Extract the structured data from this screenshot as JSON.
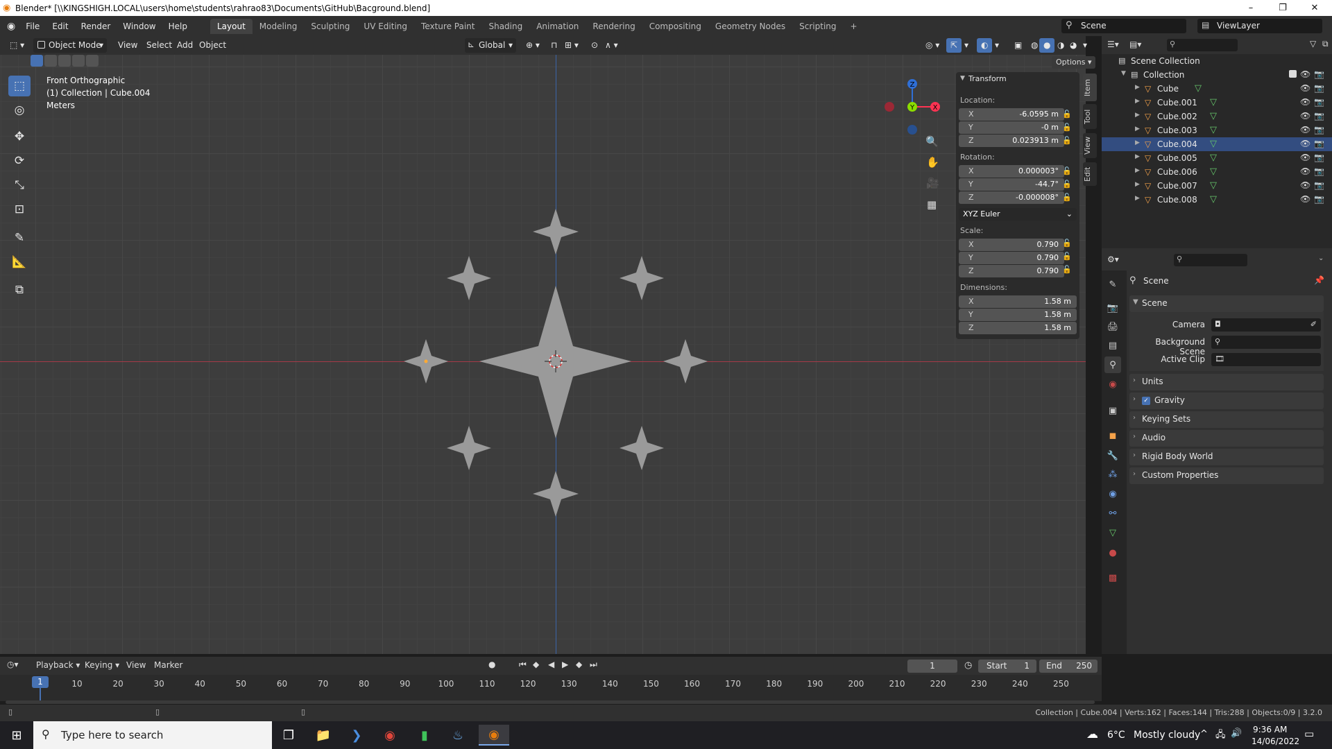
{
  "window": {
    "title": "Blender* [\\\\KINGSHIGH.LOCAL\\users\\home\\students\\rahrao83\\Documents\\GitHub\\Bacground.blend]",
    "minimize": "–",
    "maximize": "❐",
    "close": "✕"
  },
  "menu": {
    "items": [
      "File",
      "Edit",
      "Render",
      "Window",
      "Help"
    ],
    "workspaces": [
      "Layout",
      "Modeling",
      "Sculpting",
      "UV Editing",
      "Texture Paint",
      "Shading",
      "Animation",
      "Rendering",
      "Compositing",
      "Geometry Nodes",
      "Scripting"
    ],
    "active_workspace": "Layout",
    "add_tab": "+",
    "scene": "Scene",
    "view_layer": "ViewLayer"
  },
  "viewport_header": {
    "mode": "Object Mode",
    "menus": [
      "View",
      "Select",
      "Add",
      "Object"
    ],
    "orientation": "Global",
    "options_label": "Options"
  },
  "viewport": {
    "view_name": "Front Orthographic",
    "collection_info": "(1) Collection | Cube.004",
    "units": "Meters",
    "gizmo": {
      "z": "Z",
      "y": "Y",
      "x": "X"
    }
  },
  "transform_panel": {
    "title": "Transform",
    "location_label": "Location:",
    "location": [
      {
        "axis": "X",
        "value": "-6.0595 m"
      },
      {
        "axis": "Y",
        "value": "-0 m"
      },
      {
        "axis": "Z",
        "value": "0.023913 m"
      }
    ],
    "rotation_label": "Rotation:",
    "rotation": [
      {
        "axis": "X",
        "value": "0.000003°"
      },
      {
        "axis": "Y",
        "value": "-44.7°"
      },
      {
        "axis": "Z",
        "value": "-0.000008°"
      }
    ],
    "rotation_mode": "XYZ Euler",
    "scale_label": "Scale:",
    "scale": [
      {
        "axis": "X",
        "value": "0.790"
      },
      {
        "axis": "Y",
        "value": "0.790"
      },
      {
        "axis": "Z",
        "value": "0.790"
      }
    ],
    "dimensions_label": "Dimensions:",
    "dimensions": [
      {
        "axis": "X",
        "value": "1.58 m"
      },
      {
        "axis": "Y",
        "value": "1.58 m"
      },
      {
        "axis": "Z",
        "value": "1.58 m"
      }
    ],
    "side_tabs": [
      "Item",
      "Tool",
      "View",
      "Edit"
    ]
  },
  "outliner": {
    "scene_collection": "Scene Collection",
    "collection": "Collection",
    "objects": [
      "Cube",
      "Cube.001",
      "Cube.002",
      "Cube.003",
      "Cube.004",
      "Cube.005",
      "Cube.006",
      "Cube.007",
      "Cube.008"
    ],
    "selected": "Cube.004"
  },
  "properties": {
    "context": "Scene",
    "section": "Scene",
    "camera_label": "Camera",
    "background_scene_label": "Background Scene",
    "active_clip_label": "Active Clip",
    "panels": [
      "Units",
      "Gravity",
      "Keying Sets",
      "Audio",
      "Rigid Body World",
      "Custom Properties"
    ]
  },
  "timeline": {
    "menus": [
      "Playback",
      "Keying",
      "View",
      "Marker"
    ],
    "current_frame": "1",
    "start_label": "Start",
    "start": "1",
    "end_label": "End",
    "end": "250",
    "ticks": [
      "10",
      "20",
      "30",
      "40",
      "50",
      "60",
      "70",
      "80",
      "90",
      "100",
      "110",
      "120",
      "130",
      "140",
      "150",
      "160",
      "170",
      "180",
      "190",
      "200",
      "210",
      "220",
      "230",
      "240",
      "250"
    ]
  },
  "status_bar": {
    "info": "Collection | Cube.004 | Verts:162 | Faces:144 | Tris:288 | Objects:0/9 | 3.2.0"
  },
  "taskbar": {
    "search_placeholder": "Type here to search",
    "temperature": "6°C",
    "weather": "Mostly cloudy",
    "time": "9:36 AM",
    "date": "14/06/2022"
  },
  "colors": {
    "accent_blue": "#4772b3",
    "x_axis_red": "#ff3352",
    "z_axis_blue": "#2f5fa8",
    "object_gray": "#9a9a9a",
    "outliner_selected": "#334d80"
  }
}
